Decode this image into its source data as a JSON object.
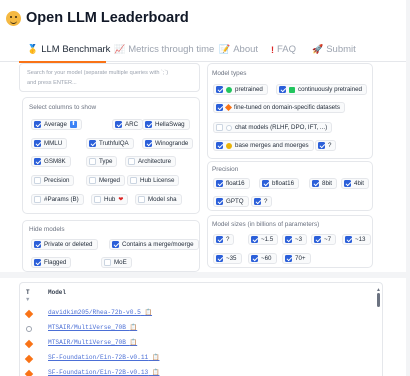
{
  "header": {
    "title": "Open LLM Leaderboard",
    "logo": "hugging-face-emoji"
  },
  "tabs": [
    {
      "label": "LLM Benchmark",
      "icon": "medal-icon",
      "active": true
    },
    {
      "label": "Metrics through time",
      "icon": "chart-icon",
      "active": false
    },
    {
      "label": "About",
      "icon": "memo-icon",
      "active": false
    },
    {
      "label": "FAQ",
      "icon": "exclamation-icon",
      "active": false
    },
    {
      "label": "Submit",
      "icon": "rocket-icon",
      "active": false
    }
  ],
  "search": {
    "placeholder_line1": "Search for your model (separate multiple queries with `;`)",
    "placeholder_line2": "and press ENTER..."
  },
  "columns": {
    "title": "Select columns to show",
    "items": [
      {
        "label": "Average",
        "checked": true
      },
      {
        "label": "ARC",
        "checked": true
      },
      {
        "label": "HellaSwag",
        "checked": true
      },
      {
        "label": "MMLU",
        "checked": true
      },
      {
        "label": "TruthfulQA",
        "checked": true
      },
      {
        "label": "Winogrande",
        "checked": true
      },
      {
        "label": "GSM8K",
        "checked": true
      },
      {
        "label": "Type",
        "checked": false
      },
      {
        "label": "Architecture",
        "checked": false
      },
      {
        "label": "Precision",
        "checked": false
      },
      {
        "label": "Merged",
        "checked": false
      },
      {
        "label": "Hub License",
        "checked": false
      },
      {
        "label": "#Params (B)",
        "checked": false
      },
      {
        "label": "Hub",
        "checked": false
      },
      {
        "label": "Model sha",
        "checked": false
      }
    ]
  },
  "hide_models": {
    "title": "Hide models",
    "items": [
      {
        "label": "Private or deleted",
        "checked": true
      },
      {
        "label": "Contains a merge/moerge",
        "checked": true
      },
      {
        "label": "Flagged",
        "checked": true
      },
      {
        "label": "MoE",
        "checked": false
      }
    ]
  },
  "model_types": {
    "title": "Model types",
    "items": [
      {
        "label": "pretrained",
        "checked": true,
        "marker_color": "#22c55e"
      },
      {
        "label": "continuously pretrained",
        "checked": true,
        "marker_color": "#16a34a"
      },
      {
        "label": "fine-tuned on domain-specific datasets",
        "checked": true,
        "marker_color": "#f97316"
      },
      {
        "label": "chat models (RLHF, DPO, IFT, ...)",
        "checked": false,
        "marker_color": "#9ca3af"
      },
      {
        "label": "base merges and moerges",
        "checked": true,
        "marker_color": "#eab308"
      },
      {
        "label": "?",
        "checked": true
      }
    ]
  },
  "precision": {
    "title": "Precision",
    "items": [
      {
        "label": "float16",
        "checked": true
      },
      {
        "label": "bfloat16",
        "checked": true
      },
      {
        "label": "8bit",
        "checked": true
      },
      {
        "label": "4bit",
        "checked": true
      },
      {
        "label": "GPTQ",
        "checked": true
      },
      {
        "label": "?",
        "checked": true
      }
    ]
  },
  "sizes": {
    "title": "Model sizes (in billions of parameters)",
    "items": [
      {
        "label": "?",
        "checked": true
      },
      {
        "label": "~1.5",
        "checked": true
      },
      {
        "label": "~3",
        "checked": true
      },
      {
        "label": "~7",
        "checked": true
      },
      {
        "label": "~13",
        "checked": true
      },
      {
        "label": "~35",
        "checked": true
      },
      {
        "label": "~60",
        "checked": true
      },
      {
        "label": "70+",
        "checked": true
      }
    ]
  },
  "table": {
    "col_t": "T",
    "col_model": "Model",
    "rows": [
      {
        "model": "davidkim205/Rhea-72b-v0.5",
        "type_color": "#f97316"
      },
      {
        "model": "MTSAIR/MultiVerse_70B",
        "type_color": "#9ca3af"
      },
      {
        "model": "MTSAIR/MultiVerse_70B",
        "type_color": "#f97316"
      },
      {
        "model": "SF-Foundation/Ein-72B-v0.11",
        "type_color": "#f97316"
      },
      {
        "model": "SF-Foundation/Ein-72B-v0.13",
        "type_color": "#f97316"
      }
    ]
  }
}
